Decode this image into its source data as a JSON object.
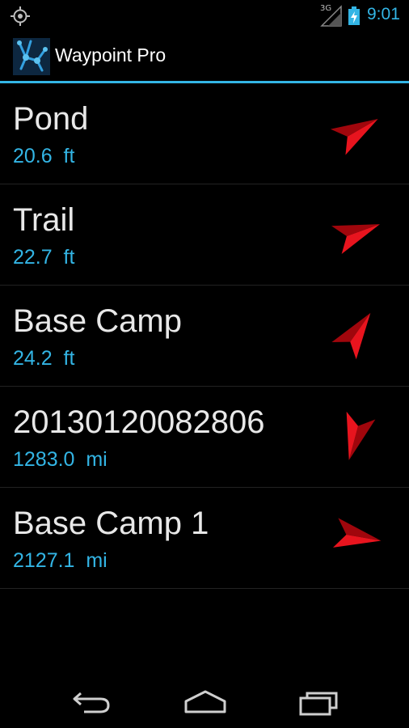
{
  "status_bar": {
    "network_label": "3G",
    "time": "9:01",
    "icons": [
      "gps-icon",
      "signal-icon",
      "battery-charging-icon"
    ]
  },
  "app": {
    "title": "Waypoint Pro",
    "icon": "waypoint-pro-logo-icon"
  },
  "colors": {
    "accent": "#33b5e5",
    "arrow": "#e8141e",
    "background": "#000000"
  },
  "waypoints": [
    {
      "name": "Pond",
      "distance": "20.6  ft",
      "bearing_deg": 60
    },
    {
      "name": "Trail",
      "distance": "22.7  ft",
      "bearing_deg": 70
    },
    {
      "name": "Base Camp",
      "distance": "24.2  ft",
      "bearing_deg": 35
    },
    {
      "name": "20130120082806",
      "distance": "1283.0  mi",
      "bearing_deg": 195
    },
    {
      "name": "Base Camp 1",
      "distance": "2127.1  mi",
      "bearing_deg": 100
    }
  ],
  "nav_bar": {
    "buttons": [
      "back-icon",
      "home-icon",
      "recent-apps-icon"
    ]
  }
}
